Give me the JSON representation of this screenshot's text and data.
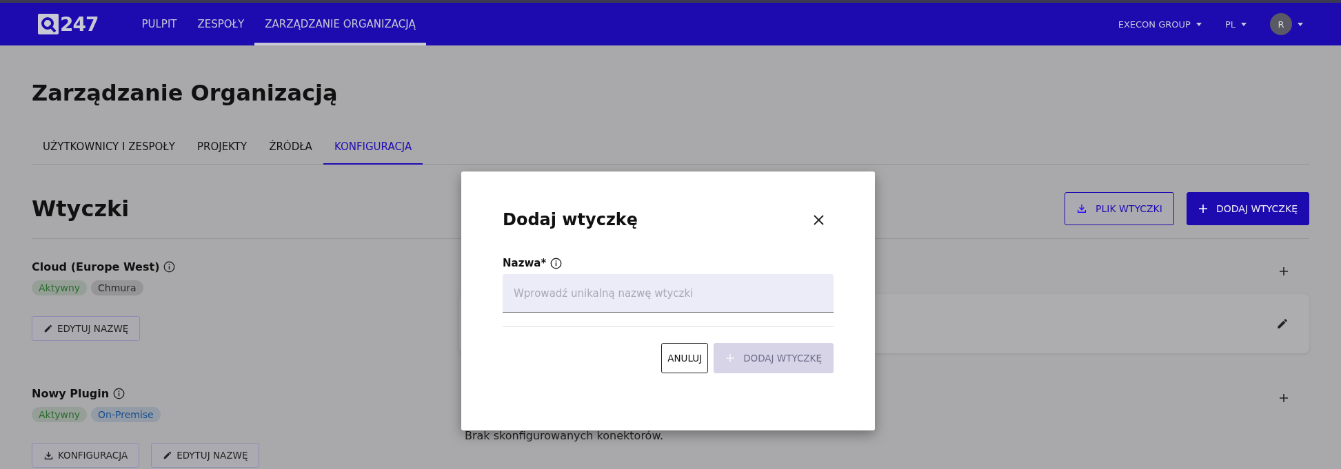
{
  "nav": {
    "logo": "247",
    "items": [
      {
        "label": "PULPIT",
        "selected": false
      },
      {
        "label": "ZESPOŁY",
        "selected": false
      },
      {
        "label": "ZARZĄDZANIE ORGANIZACJĄ",
        "selected": true
      }
    ],
    "organization": "EXECON GROUP",
    "language": "PL",
    "avatar": "R"
  },
  "page": {
    "title": "Zarządzanie Organizacją",
    "tabs": [
      {
        "label": "UŻYTKOWNICY I ZESPOŁY",
        "selected": false
      },
      {
        "label": "PROJEKTY",
        "selected": false
      },
      {
        "label": "ŹRÓDŁA",
        "selected": false
      },
      {
        "label": "KONFIGURACJA",
        "selected": true
      }
    ],
    "section_title": "Wtyczki",
    "actions": [
      {
        "kind": "outline",
        "label": "PLIK WTYCZKI"
      },
      {
        "kind": "primary",
        "label": "DODAJ WTYCZKĘ"
      }
    ],
    "plugins": [
      {
        "name": "Cloud (Europe West)",
        "tags": [
          {
            "label": "Aktywny",
            "color": "#2a6b2c"
          },
          {
            "label": "Chmura",
            "color": "#2b2b2b"
          }
        ],
        "buttons": [
          {
            "kind": "edit",
            "label": "EDYTUJ NAZWĘ"
          }
        ],
        "connectors": {
          "kind": "card"
        }
      },
      {
        "name": "Nowy Plugin",
        "tags": [
          {
            "label": "Aktywny",
            "color": "#2a6b2c"
          },
          {
            "label": "On-Premise",
            "color": "#1a4f8c"
          }
        ],
        "buttons": [
          {
            "kind": "download",
            "label": "KONFIGURACJA"
          },
          {
            "kind": "edit",
            "label": "EDYTUJ NAZWĘ"
          }
        ],
        "connectors": {
          "kind": "empty",
          "message": "Brak skonfigurowanych konektorów."
        }
      }
    ]
  },
  "dialog": {
    "title": "Dodaj wtyczkę",
    "field_label": "Nazwa*",
    "placeholder": "Wprowadź unikalną nazwę wtyczki",
    "buttons": [
      {
        "kind": "cancel",
        "label": "ANULUJ",
        "disabled": false
      },
      {
        "kind": "submit",
        "label": "DODAJ WTYCZKĘ",
        "disabled": true
      }
    ]
  }
}
